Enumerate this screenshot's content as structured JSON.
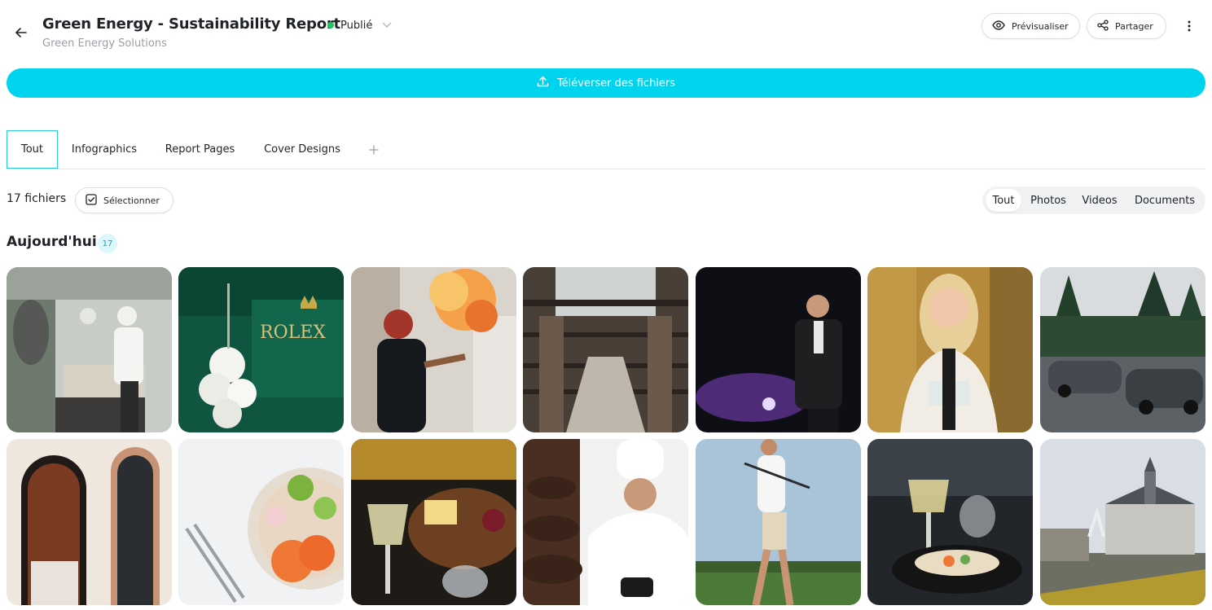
{
  "header": {
    "title": "Green Energy - Sustainability Report",
    "subtitle": "Green Energy Solutions",
    "status": "Publié",
    "preview_label": "Prévisualiser",
    "share_label": "Partager"
  },
  "upload": {
    "label": "Téléverser des fichiers"
  },
  "tabs": [
    {
      "label": "Tout"
    },
    {
      "label": "Infographics"
    },
    {
      "label": "Report Pages"
    },
    {
      "label": "Cover Designs"
    }
  ],
  "toolbar": {
    "count_label": "17 fichiers",
    "select_label": "Sélectionner"
  },
  "filters": [
    {
      "label": "Tout"
    },
    {
      "label": "Photos"
    },
    {
      "label": "Videos"
    },
    {
      "label": "Documents"
    }
  ],
  "section": {
    "title": "Aujourd'hui",
    "count": "17"
  },
  "colors": {
    "accent": "#00d3ee",
    "published": "#22c55e",
    "tab_border": "#2bc7df"
  },
  "icons": [
    "back-arrow-icon",
    "chevron-down-icon",
    "eye-icon",
    "share-icon",
    "more-vertical-icon",
    "upload-icon",
    "plus-icon",
    "checkbox-icon"
  ]
}
